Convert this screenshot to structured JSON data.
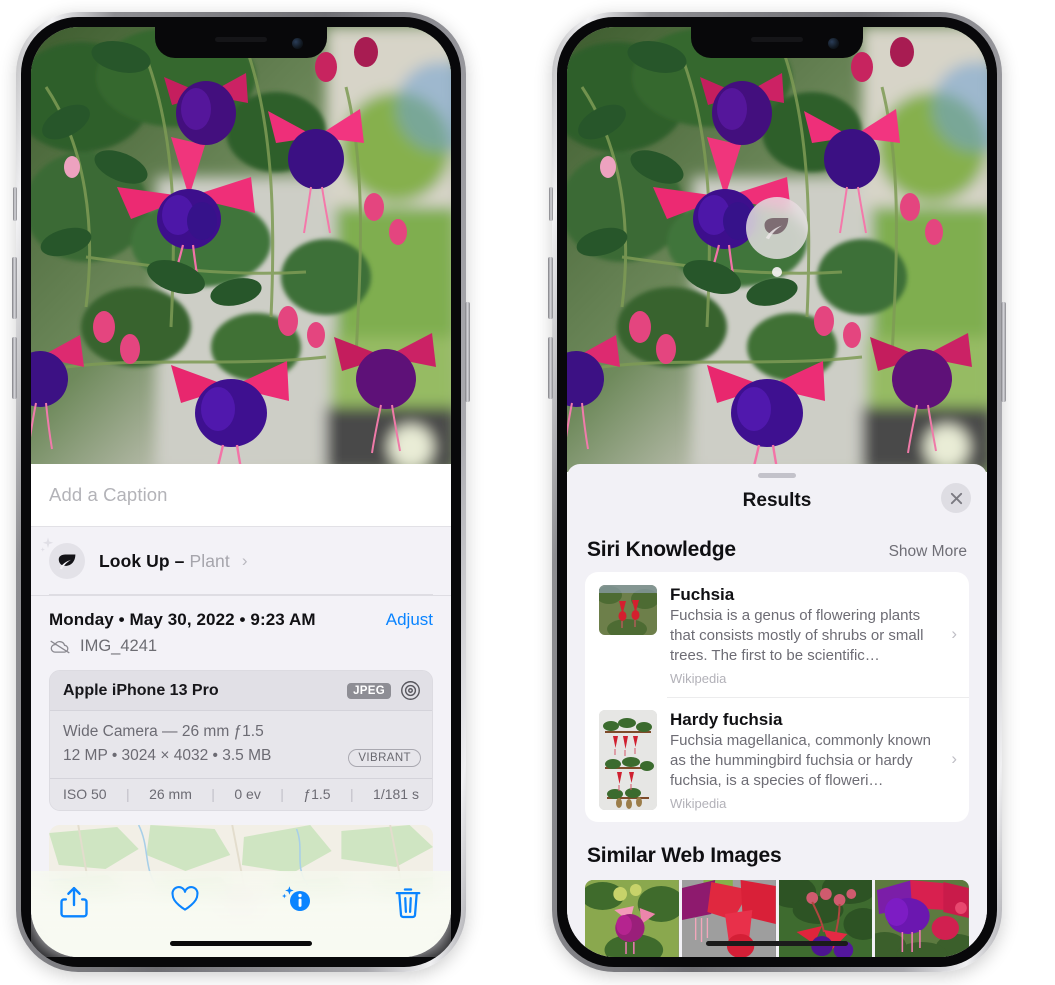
{
  "left_phone": {
    "caption_placeholder": "Add a Caption",
    "lookup": {
      "label": "Look Up",
      "dash": " – ",
      "kind": "Plant",
      "chevron": "›",
      "icon": "leaf-icon"
    },
    "metadata": {
      "date_line": "Monday • May 30, 2022 • 9:23 AM",
      "adjust_label": "Adjust",
      "filename": "IMG_4241",
      "cloud_icon": "icloud-slash-icon"
    },
    "camera_card": {
      "device": "Apple iPhone 13 Pro",
      "format_badge": "JPEG",
      "aperture_icon": "aperture-icon",
      "lens_line": "Wide Camera — 26 mm ƒ1.5",
      "spec_line": "12 MP • 3024 × 4032 • 3.5 MB",
      "style_badge": "VIBRANT",
      "exif": [
        "ISO 50",
        "26 mm",
        "0 ev",
        "ƒ1.5",
        "1/181 s"
      ],
      "exif_separator": "|"
    },
    "toolbar": [
      {
        "name": "share-icon",
        "label": "Share"
      },
      {
        "name": "heart-icon",
        "label": "Favorite"
      },
      {
        "name": "info-sparkle-icon",
        "label": "Info"
      },
      {
        "name": "trash-icon",
        "label": "Delete"
      }
    ]
  },
  "right_phone": {
    "pin": {
      "icon": "leaf-icon"
    },
    "sheet": {
      "title": "Results",
      "close_icon": "close-icon",
      "sections": [
        {
          "title": "Siri Knowledge",
          "action": "Show More",
          "items": [
            {
              "title": "Fuchsia",
              "description": "Fuchsia is a genus of flowering plants that consists mostly of shrubs or small trees. The first to be scientific…",
              "source": "Wikipedia",
              "chevron": "›"
            },
            {
              "title": "Hardy fuchsia",
              "description": "Fuchsia magellanica, commonly known as the hummingbird fuchsia or hardy fuchsia, is a species of floweri…",
              "source": "Wikipedia",
              "chevron": "›"
            }
          ]
        },
        {
          "title": "Similar Web Images",
          "items": [
            "web-image-1",
            "web-image-2",
            "web-image-3",
            "web-image-4"
          ]
        }
      ]
    }
  },
  "colors": {
    "accent_blue": "#0a84ff",
    "sheet_gray": "#f2f1f6",
    "card_white": "#ffffff",
    "secondary_text": "#6d6c74",
    "tertiary_text": "#b2b1b8"
  }
}
